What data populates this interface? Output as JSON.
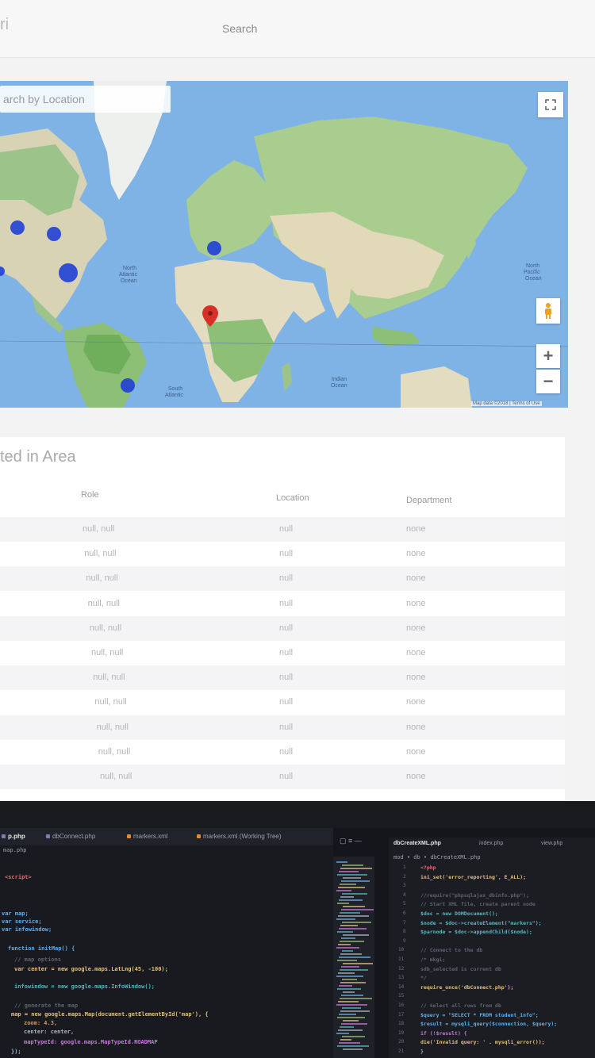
{
  "nav": {
    "brand": "ri",
    "search_label": "Search"
  },
  "map": {
    "search_placeholder": "arch by Location",
    "fullscreen_icon": "fullscreen-icon",
    "zoom_in_label": "+",
    "zoom_out_label": "−",
    "attribution": "Map data ©2018 | Terms of Use",
    "labels": {
      "north_pacific": "North\nPacific\nOcean",
      "south_atlantic": "South\nAtlantic\nOcean",
      "indian": "Indian\nOcean",
      "north_pacific_2": "North\nPacific\nOcean"
    },
    "colors": {
      "ocean": "#7fb3e6",
      "land": "#e4dcc1",
      "forest": "#9cc48a",
      "marker": "#1f3fd6",
      "pin": "#d93025"
    }
  },
  "table": {
    "title": "ted in Area",
    "headers": {
      "role": "Role",
      "location": "Location",
      "department": "Department"
    },
    "rows": [
      {
        "role": "null, null",
        "location": "null",
        "department": "none"
      },
      {
        "role": "null, null",
        "location": "null",
        "department": "none"
      },
      {
        "role": "null, null",
        "location": "null",
        "department": "none"
      },
      {
        "role": "null, null",
        "location": "null",
        "department": "none"
      },
      {
        "role": "null, null",
        "location": "null",
        "department": "none"
      },
      {
        "role": "null, null",
        "location": "null",
        "department": "none"
      },
      {
        "role": "null, null",
        "location": "null",
        "department": "none"
      },
      {
        "role": "null, null",
        "location": "null",
        "department": "none"
      },
      {
        "role": "null, null",
        "location": "null",
        "department": "none"
      },
      {
        "role": "null, null",
        "location": "null",
        "department": "none"
      },
      {
        "role": "null, null",
        "location": "null",
        "department": "none"
      }
    ]
  },
  "editor": {
    "tabs": [
      {
        "label": "p.php",
        "active": true,
        "icon_color": "#7b7fb5"
      },
      {
        "label": "dbConnect.php",
        "active": false,
        "icon_color": "#7b7fb5"
      },
      {
        "label": "markers.xml",
        "active": false,
        "icon_color": "#e08a3c"
      },
      {
        "label": "markers.xml (Working Tree)",
        "active": false,
        "icon_color": "#e08a3c"
      }
    ],
    "breadcrumb": "map.php",
    "right_tabs": [
      {
        "label": "dbCreateXML.php",
        "active": true
      },
      {
        "label": "index.php",
        "active": false
      },
      {
        "label": "view.php",
        "active": false
      }
    ],
    "right_breadcrumb": "mod • db • dbCreateXML.php",
    "left_code": [
      {
        "text": "<script>",
        "color": "#e06c75"
      },
      {
        "text": "var map;",
        "color": "#61afef"
      },
      {
        "text": "var service;",
        "color": "#61afef"
      },
      {
        "text": "var infowindow;",
        "color": "#61afef"
      },
      {
        "text": "function initMap() {",
        "color": "#61afef"
      },
      {
        "text": "  // map options",
        "color": "#5c6370"
      },
      {
        "text": "  var center = new google.maps.LatLng(45, -100);",
        "color": "#e5c07b"
      },
      {
        "text": "  infowindow = new google.maps.InfoWindow();",
        "color": "#56b6c2"
      },
      {
        "text": "  // generate the map",
        "color": "#5c6370"
      },
      {
        "text": "  map = new google.maps.Map(document.getElementById('map'), {",
        "color": "#e5c07b"
      },
      {
        "text": "    zoom: 4.3,",
        "color": "#d19a66"
      },
      {
        "text": "    center: center,",
        "color": "#abb2bf"
      },
      {
        "text": "    mapTypeId: google.maps.MapTypeId.ROADMAP",
        "color": "#c678dd"
      },
      {
        "text": "});",
        "color": "#abb2bf"
      }
    ],
    "right_code": [
      {
        "num": "1",
        "text": "<?php",
        "color": "#e06c75"
      },
      {
        "num": "2",
        "text": "ini_set('error_reporting', E_ALL);",
        "color": "#e5c07b"
      },
      {
        "num": "3",
        "text": "",
        "color": "#abb2bf"
      },
      {
        "num": "4",
        "text": "//require(\"phpsqlajax_dbinfo.php\");",
        "color": "#5c6370"
      },
      {
        "num": "5",
        "text": "// Start XML file, create parent node",
        "color": "#5c6370"
      },
      {
        "num": "6",
        "text": "$doc = new DOMDocument();",
        "color": "#56b6c2"
      },
      {
        "num": "7",
        "text": "$node = $doc->createElement(\"markers\");",
        "color": "#56b6c2"
      },
      {
        "num": "8",
        "text": "$parnode = $doc->appendChild($node);",
        "color": "#56b6c2"
      },
      {
        "num": "9",
        "text": "",
        "color": "#abb2bf"
      },
      {
        "num": "10",
        "text": "// Connect to the db",
        "color": "#5c6370"
      },
      {
        "num": "11",
        "text": "/* mkgi;",
        "color": "#5c6370"
      },
      {
        "num": "12",
        "text": "   sdb_selected is current db",
        "color": "#5c6370"
      },
      {
        "num": "13",
        "text": "*/",
        "color": "#5c6370"
      },
      {
        "num": "14",
        "text": "require_once('dbConnect.php');",
        "color": "#e5c07b"
      },
      {
        "num": "15",
        "text": "",
        "color": "#abb2bf"
      },
      {
        "num": "16",
        "text": "// Select all rows from db",
        "color": "#5c6370"
      },
      {
        "num": "17",
        "text": "$query = \"SELECT * FROM student_info\";",
        "color": "#61afef"
      },
      {
        "num": "18",
        "text": "$result = mysqli_query($connection, $query);",
        "color": "#61afef"
      },
      {
        "num": "19",
        "text": "if (!$result) {",
        "color": "#c678dd"
      },
      {
        "num": "20",
        "text": "  die('Invalid query: ' . mysqli_error());",
        "color": "#e5c07b"
      },
      {
        "num": "21",
        "text": "}",
        "color": "#abb2bf"
      }
    ]
  }
}
